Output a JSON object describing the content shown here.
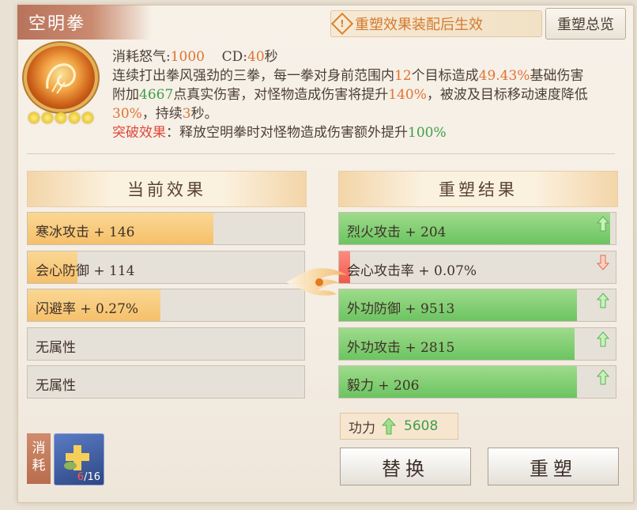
{
  "title": "空明拳",
  "notice": "重塑效果装配后生效",
  "overview_button": "重塑总览",
  "skill": {
    "rage_label": "消耗怒气:",
    "rage_value": "1000",
    "cd_label": "CD:",
    "cd_value": "40",
    "cd_unit": "秒",
    "desc_parts": {
      "p1": "连续打出拳风强劲的三拳，每一拳对身前范围内",
      "targets": "12",
      "p2": "个目标造成",
      "pct": "49.43%",
      "p3": "基础伤害附加",
      "true_dmg": "4667",
      "p4": "点真实伤害，对怪物造成伤害将提升",
      "monster_pct": "140%",
      "p5": "，被波及目标移动速度降低",
      "slow": "30%",
      "p6": "，持续",
      "dur": "3",
      "p7": "秒。",
      "break_label": "突破效果",
      "break_text": "：释放空明拳时对怪物造成伤害额外提升",
      "break_pct": "100%"
    },
    "stars": 5
  },
  "current": {
    "header": "当前效果",
    "rows": [
      {
        "label": "寒冰攻击 + 146",
        "fill": 0.67
      },
      {
        "label": "会心防御 + 114",
        "fill": 0.18
      },
      {
        "label": "闪避率 + 0.27%",
        "fill": 0.48
      },
      {
        "label": "无属性",
        "fill": 0
      },
      {
        "label": "无属性",
        "fill": 0
      }
    ]
  },
  "result": {
    "header": "重塑结果",
    "rows": [
      {
        "label": "烈火攻击 + 204",
        "fill": 0.98,
        "trend": "up"
      },
      {
        "label": "会心攻击率 + 0.07%",
        "fill": 0.04,
        "trend": "down"
      },
      {
        "label": "外功防御 + 9513",
        "fill": 0.86,
        "trend": "up"
      },
      {
        "label": "外功攻击 + 2815",
        "fill": 0.85,
        "trend": "up"
      },
      {
        "label": "毅力 + 206",
        "fill": 0.86,
        "trend": "up"
      }
    ]
  },
  "power": {
    "label": "功力",
    "value": "5608"
  },
  "buttons": {
    "replace": "替换",
    "reforge": "重塑"
  },
  "consume": {
    "tag": "消耗",
    "have": "6",
    "need": "16"
  },
  "colors": {
    "accent": "#e07333",
    "green": "#3f9e49",
    "title_bg": "#b8735b"
  },
  "icons": [
    "warning-icon",
    "skill-fist-icon",
    "star-icon",
    "up-arrow-icon",
    "down-arrow-icon",
    "emblem-arrow-icon",
    "reforge-material-icon"
  ]
}
